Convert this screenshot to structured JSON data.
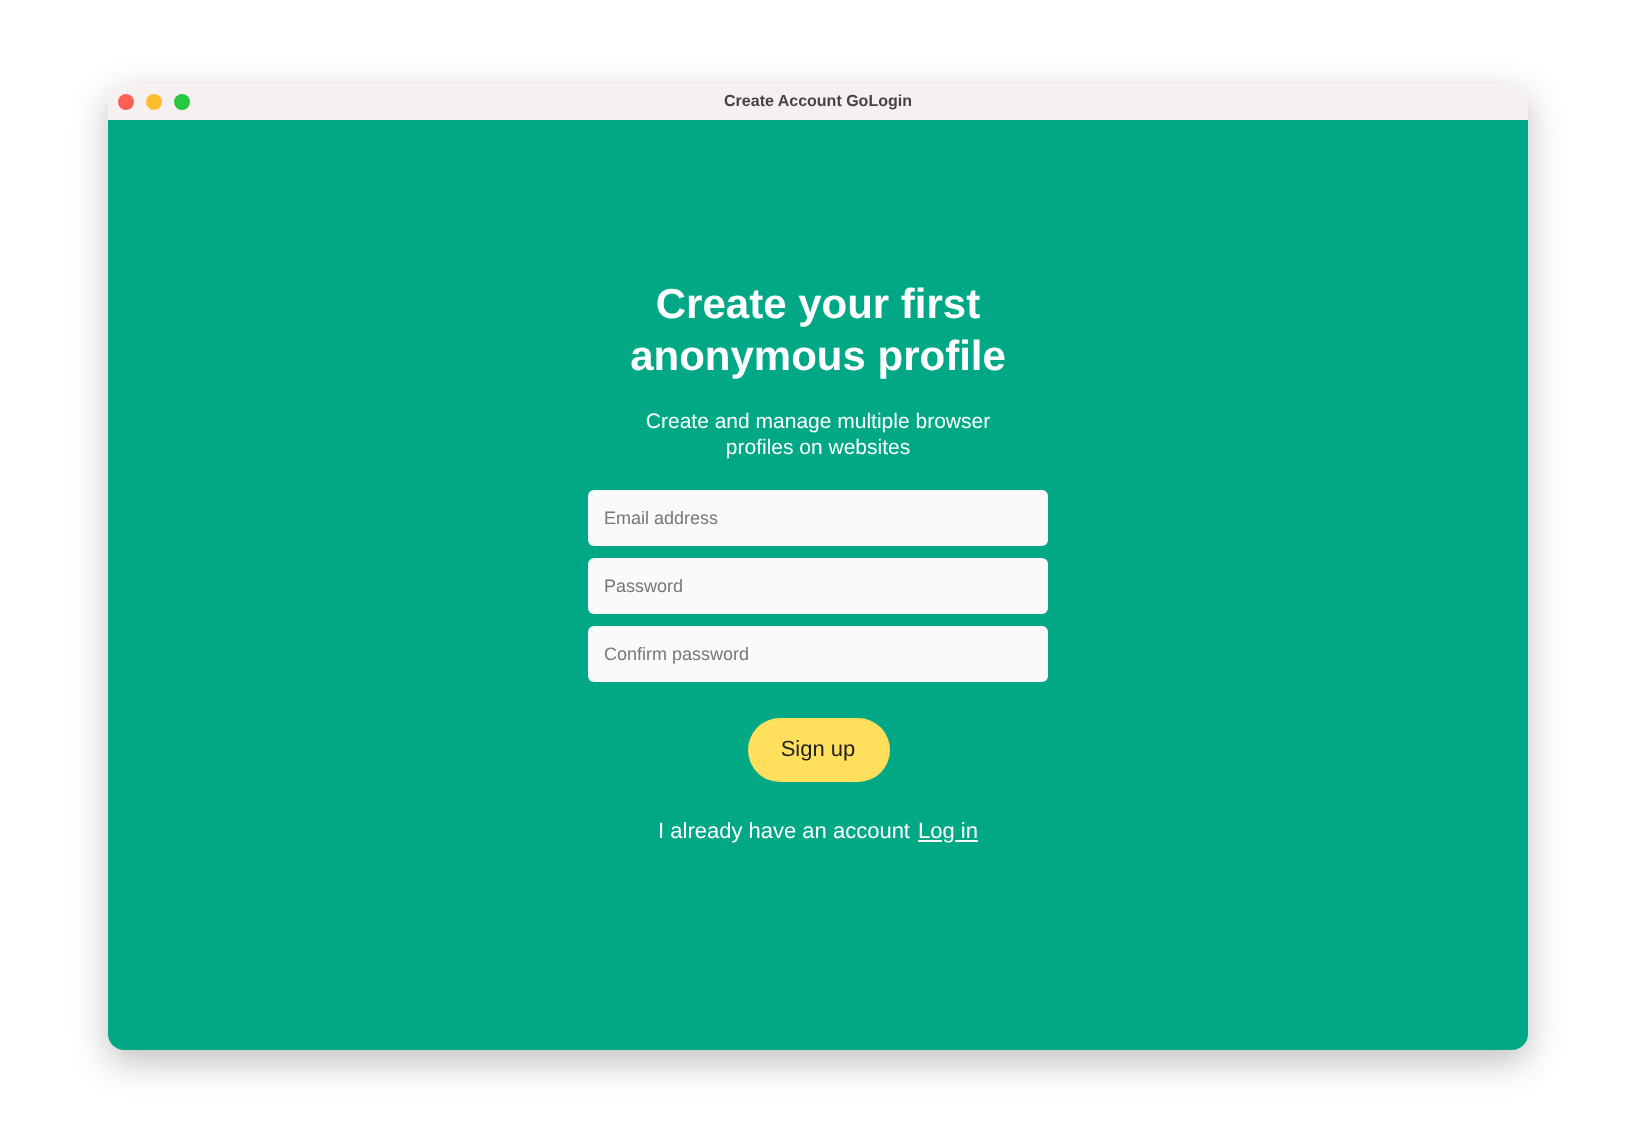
{
  "window": {
    "title": "Create Account GoLogin"
  },
  "heading": "Create your first anonymous profile",
  "subtitle": "Create and manage multiple browser profiles on websites",
  "fields": [
    {
      "placeholder": "Email address"
    },
    {
      "placeholder": "Password"
    },
    {
      "placeholder": "Confirm password"
    }
  ],
  "submit": "Sign up",
  "footer": {
    "text": "I already have an account",
    "link": "Log in"
  }
}
